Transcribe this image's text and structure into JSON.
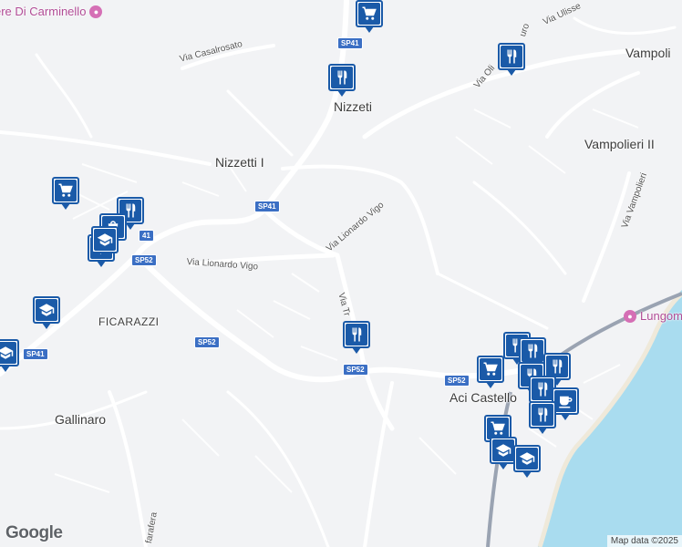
{
  "colors": {
    "sea": "#a9dcef",
    "road": "#ffffff",
    "highway": "#9aa3b2",
    "pin": "#1a5aa8",
    "background": "#f2f3f5"
  },
  "places": [
    {
      "id": "nizzeti",
      "text": "Nizzeti"
    },
    {
      "id": "nizzetti-i",
      "text": "Nizzetti I"
    },
    {
      "id": "ficarazzi",
      "text": "FICARAZZI"
    },
    {
      "id": "gallinaro",
      "text": "Gallinaro"
    },
    {
      "id": "aci-castello",
      "text": "Aci Castello"
    },
    {
      "id": "vampolieri",
      "text": "Vampoli"
    },
    {
      "id": "vampolieri-ii",
      "text": "Vampolieri II"
    }
  ],
  "streets": [
    {
      "id": "via-casalrosato",
      "text": "Via Casalrosato"
    },
    {
      "id": "via-lionardo-vigo-1",
      "text": "Via Lionardo Vigo"
    },
    {
      "id": "via-lionardo-vigo-2",
      "text": "Via Lionardo Vigo"
    },
    {
      "id": "via-tr",
      "text": "Via Tr"
    },
    {
      "id": "via-ulisse",
      "text": "Via Ulisse"
    },
    {
      "id": "via-oli",
      "text": "Via Oli"
    },
    {
      "id": "uro",
      "text": "uro"
    },
    {
      "id": "via-vampolieri",
      "text": "Via Vampolieri"
    },
    {
      "id": "farafera",
      "text": "farafera"
    }
  ],
  "shields": [
    {
      "id": "sp41-top",
      "text": "SP41"
    },
    {
      "id": "sp41-mid",
      "text": "SP41"
    },
    {
      "id": "sp41-left",
      "text": "41"
    },
    {
      "id": "sp41-west",
      "text": "SP41"
    },
    {
      "id": "sp52-a",
      "text": "SP52"
    },
    {
      "id": "sp52-b",
      "text": "SP52"
    },
    {
      "id": "sp52-c",
      "text": "SP52"
    },
    {
      "id": "sp52-d",
      "text": "SP52"
    }
  ],
  "pois": [
    {
      "id": "carminello",
      "text": "ere Di Carminello",
      "icon": "camera-icon"
    },
    {
      "id": "lungomare",
      "text": "Lungom",
      "icon": "camera-icon"
    }
  ],
  "pins": [
    {
      "type": "shopping-cart"
    },
    {
      "type": "restaurant"
    },
    {
      "type": "restaurant"
    },
    {
      "type": "shopping-cart"
    },
    {
      "type": "restaurant"
    },
    {
      "type": "shopping-bag"
    },
    {
      "type": "school"
    },
    {
      "type": "school"
    },
    {
      "type": "school"
    },
    {
      "type": "school"
    },
    {
      "type": "restaurant"
    },
    {
      "type": "restaurant"
    },
    {
      "type": "restaurant"
    },
    {
      "type": "restaurant"
    },
    {
      "type": "shopping-cart"
    },
    {
      "type": "restaurant"
    },
    {
      "type": "restaurant"
    },
    {
      "type": "cafe"
    },
    {
      "type": "restaurant"
    },
    {
      "type": "shopping-cart"
    },
    {
      "type": "school"
    },
    {
      "type": "school"
    }
  ],
  "footer": {
    "logo": "Google",
    "attribution": "Map data ©2025"
  }
}
